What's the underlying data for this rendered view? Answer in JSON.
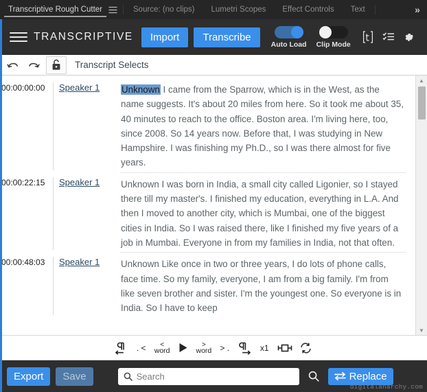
{
  "tabbar": {
    "tabs": [
      {
        "label": "Transcriptive Rough Cutter",
        "active": true
      },
      {
        "label": "Source: (no clips)",
        "active": false
      },
      {
        "label": "Lumetri Scopes",
        "active": false
      },
      {
        "label": "Effect Controls",
        "active": false
      },
      {
        "label": "Text",
        "active": false
      }
    ],
    "panel_menu_icon": "hamburger-icon",
    "overflow_label": "»"
  },
  "toolbar": {
    "menu_icon": "hamburger-icon",
    "brand": "TRANSCRIPTIVE",
    "import_label": "Import",
    "transcribe_label": "Transcribe",
    "auto_load": {
      "label": "Auto Load",
      "state": "on"
    },
    "clip_mode": {
      "label": "Clip Mode",
      "state": "off"
    },
    "icons": [
      {
        "name": "transcriptive-t-icon",
        "glyph": "[t]"
      },
      {
        "name": "checklist-icon",
        "glyph": "list"
      },
      {
        "name": "gear-icon",
        "glyph": "gear"
      }
    ],
    "accent_color": "#3a8fea"
  },
  "subbar": {
    "undo_icon": "undo-icon",
    "redo_icon": "redo-icon",
    "lock_icon": "unlocked-padlock-icon",
    "title": "Transcript Selects"
  },
  "transcript": {
    "rows": [
      {
        "time": "00:00:00:00",
        "speaker": "Speaker 1",
        "tag": "Unknown",
        "tag_highlighted": true,
        "text": " I came from the Sparrow, which is in the West, as the name suggests. It's about 20 miles from here. So it took me about 35, 40 minutes to reach to the office. Boston area. I'm living here, too, since 2008. So 14 years now. Before that, I was studying in New Hampshire. I was finishing my Ph.D., so I was there almost for five years."
      },
      {
        "time": "00:00:22:15",
        "speaker": "Speaker 1",
        "tag": "Unknown",
        "tag_highlighted": false,
        "text": " I was born in India, a small city called Ligonier, so I stayed there till my master's. I finished my education, everything in L.A. And then I moved to another city, which is Mumbai, one of the biggest cities in India. So I was raised there, like I finished my five years of a job in Mumbai. Everyone in from my families in India, not that often."
      },
      {
        "time": "00:00:48:03",
        "speaker": "Speaker 1",
        "tag": "Unknown",
        "tag_highlighted": false,
        "text": " Like once in two or three years, I do lots of phone calls, face time. So my family, everyone, I am from a big family. I'm from like seven brother and sister. I'm the youngest one. So everyone is in India. So I have to keep"
      }
    ],
    "highlight_color": "#6b9bd2",
    "scrollbar": {
      "up_arrow": "▲",
      "down_arrow": "▼"
    }
  },
  "playbar": {
    "buttons": [
      {
        "name": "prev-paragraph-button",
        "label": "¶←"
      },
      {
        "name": "prev-sentence-button",
        "label": ". <"
      },
      {
        "name": "prev-word-button",
        "label": "word",
        "chev": "<"
      },
      {
        "name": "play-button",
        "label": "▶"
      },
      {
        "name": "next-word-button",
        "label": "word",
        "chev": ">"
      },
      {
        "name": "next-sentence-button",
        "label": "> ."
      },
      {
        "name": "next-paragraph-button",
        "label": "¶→"
      },
      {
        "name": "playback-speed-button",
        "label": "x1"
      },
      {
        "name": "insert-marker-button",
        "label": "marker"
      },
      {
        "name": "refresh-sync-button",
        "label": "refresh"
      }
    ]
  },
  "footer": {
    "export_label": "Export",
    "save_label": "Save",
    "search_placeholder": "Search",
    "search_value": "",
    "search_icon": "magnifier-icon",
    "find_icon": "magnifier-icon",
    "replace_label": "Replace",
    "replace_icon": "swap-arrows-icon",
    "watermark": "digitalanarchy.com"
  }
}
